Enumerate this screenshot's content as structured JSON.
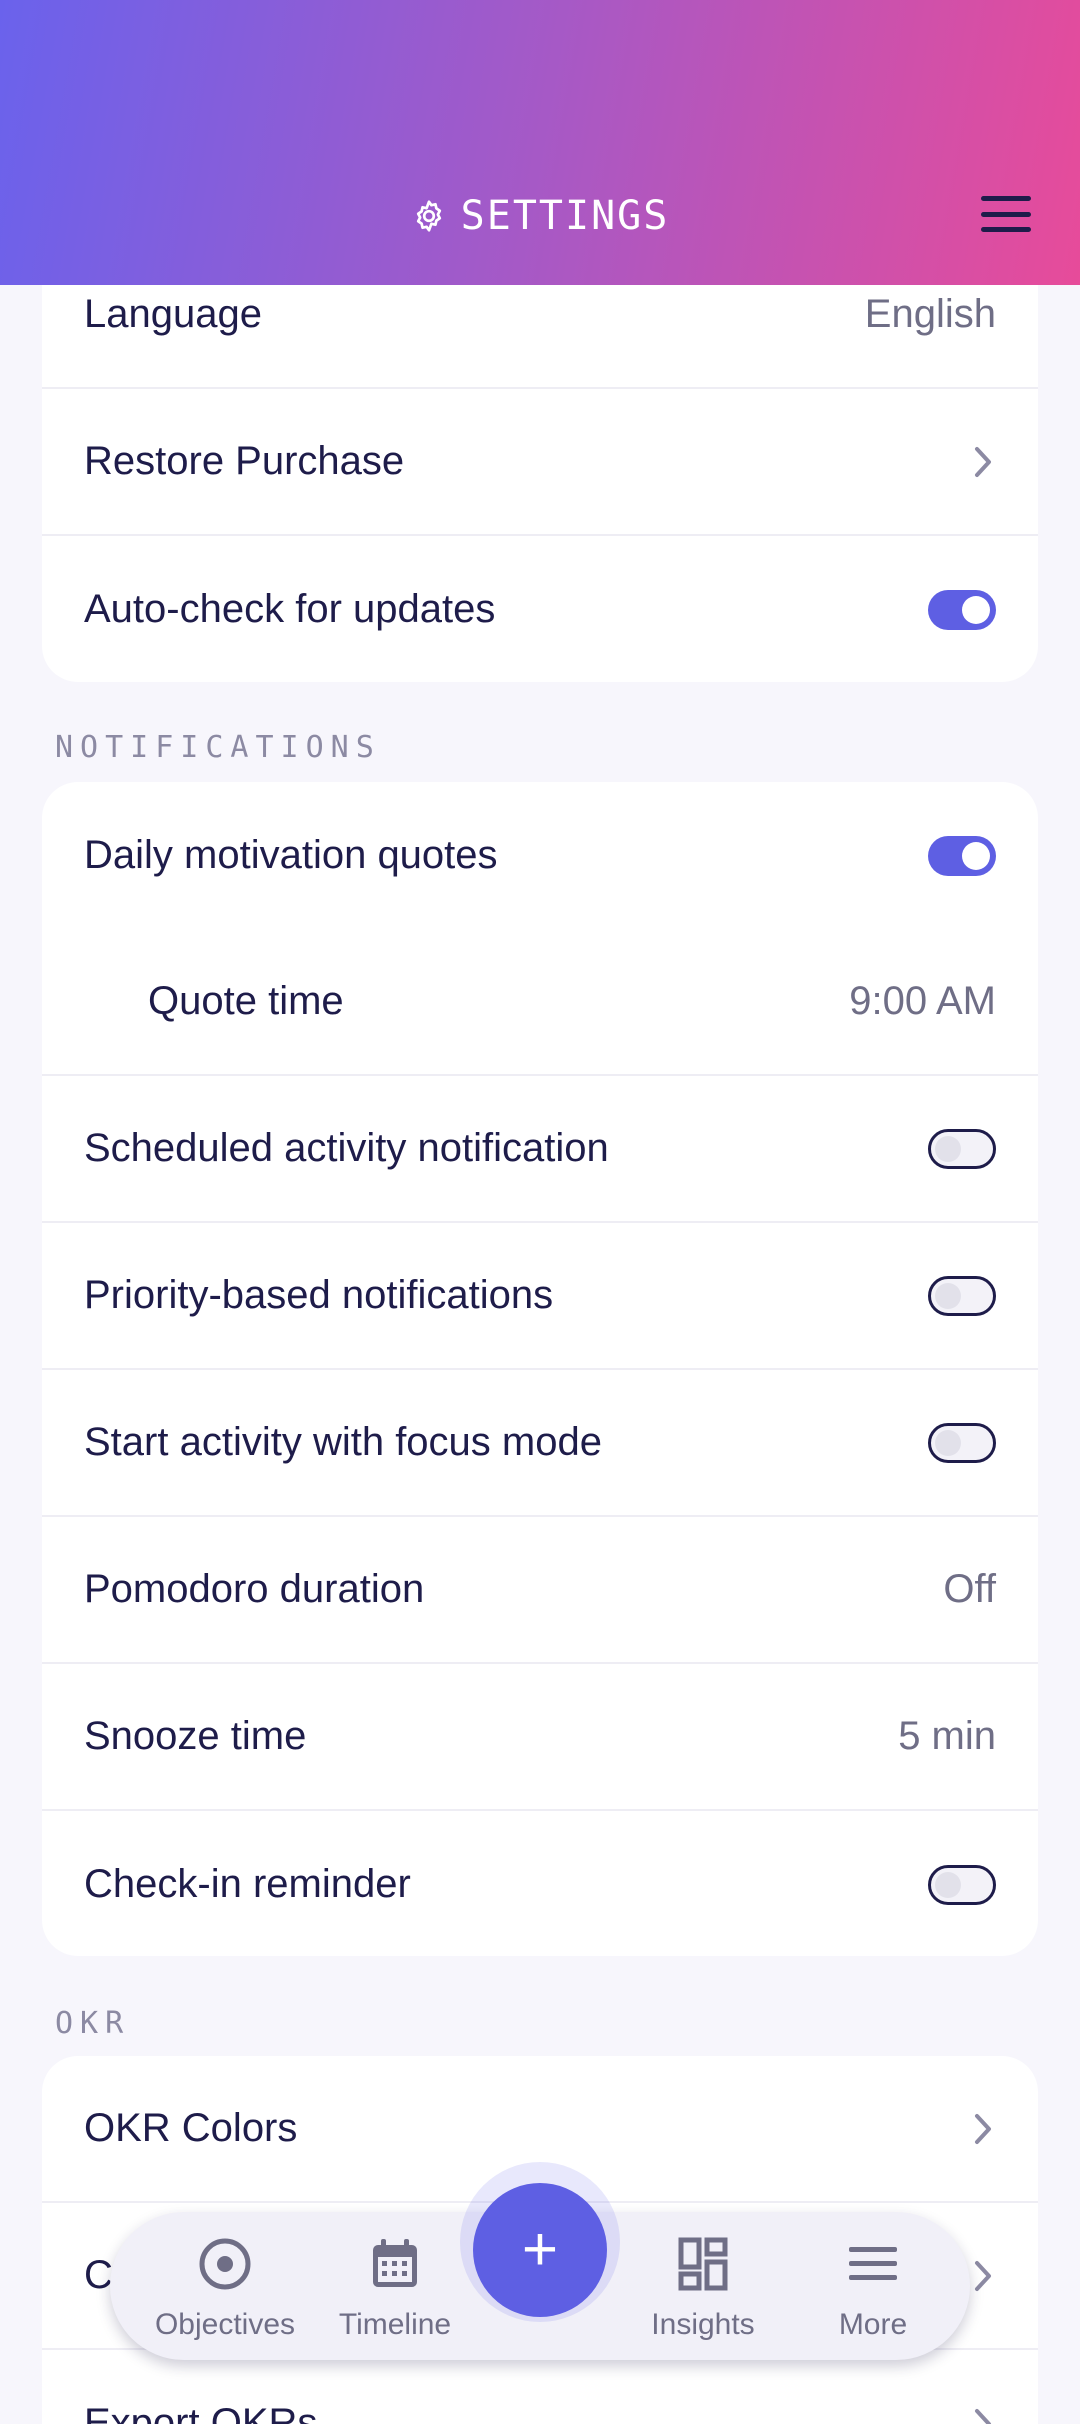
{
  "header": {
    "title": "SETTINGS",
    "icon": "gear-icon",
    "menu_icon": "hamburger-menu-icon"
  },
  "general": {
    "language": {
      "label": "Language",
      "value": "English"
    },
    "restore_purchase": {
      "label": "Restore Purchase"
    },
    "auto_check": {
      "label": "Auto-check for updates",
      "enabled": true
    }
  },
  "notifications": {
    "section_label": "NOTIFICATIONS",
    "daily_quotes": {
      "label": "Daily motivation quotes",
      "enabled": true
    },
    "quote_time": {
      "label": "Quote time",
      "value": "9:00 AM"
    },
    "scheduled_activity": {
      "label": "Scheduled activity notification",
      "enabled": false
    },
    "priority_based": {
      "label": "Priority-based notifications",
      "enabled": false
    },
    "focus_mode": {
      "label": "Start activity with focus mode",
      "enabled": false
    },
    "pomodoro": {
      "label": "Pomodoro duration",
      "value": "Off"
    },
    "snooze": {
      "label": "Snooze time",
      "value": "5 min"
    },
    "check_in": {
      "label": "Check-in reminder",
      "enabled": false
    }
  },
  "okr": {
    "section_label": "OKR",
    "colors": {
      "label": "OKR Colors"
    },
    "partial_row": {
      "label": "C"
    },
    "export": {
      "label": "Export OKRs"
    }
  },
  "bottom_nav": {
    "items": [
      {
        "label": "Objectives",
        "icon": "target-icon"
      },
      {
        "label": "Timeline",
        "icon": "calendar-icon"
      },
      {
        "label": "Insights",
        "icon": "dashboard-icon"
      },
      {
        "label": "More",
        "icon": "more-menu-icon"
      }
    ],
    "fab_label": "+"
  },
  "colors": {
    "accent": "#5e5fe3",
    "header_gradient_start": "#6a62ec",
    "header_gradient_end": "#e74b9a",
    "text_primary": "#1e1c4a",
    "text_secondary": "#6f6e86",
    "background": "#f7f6fc"
  }
}
